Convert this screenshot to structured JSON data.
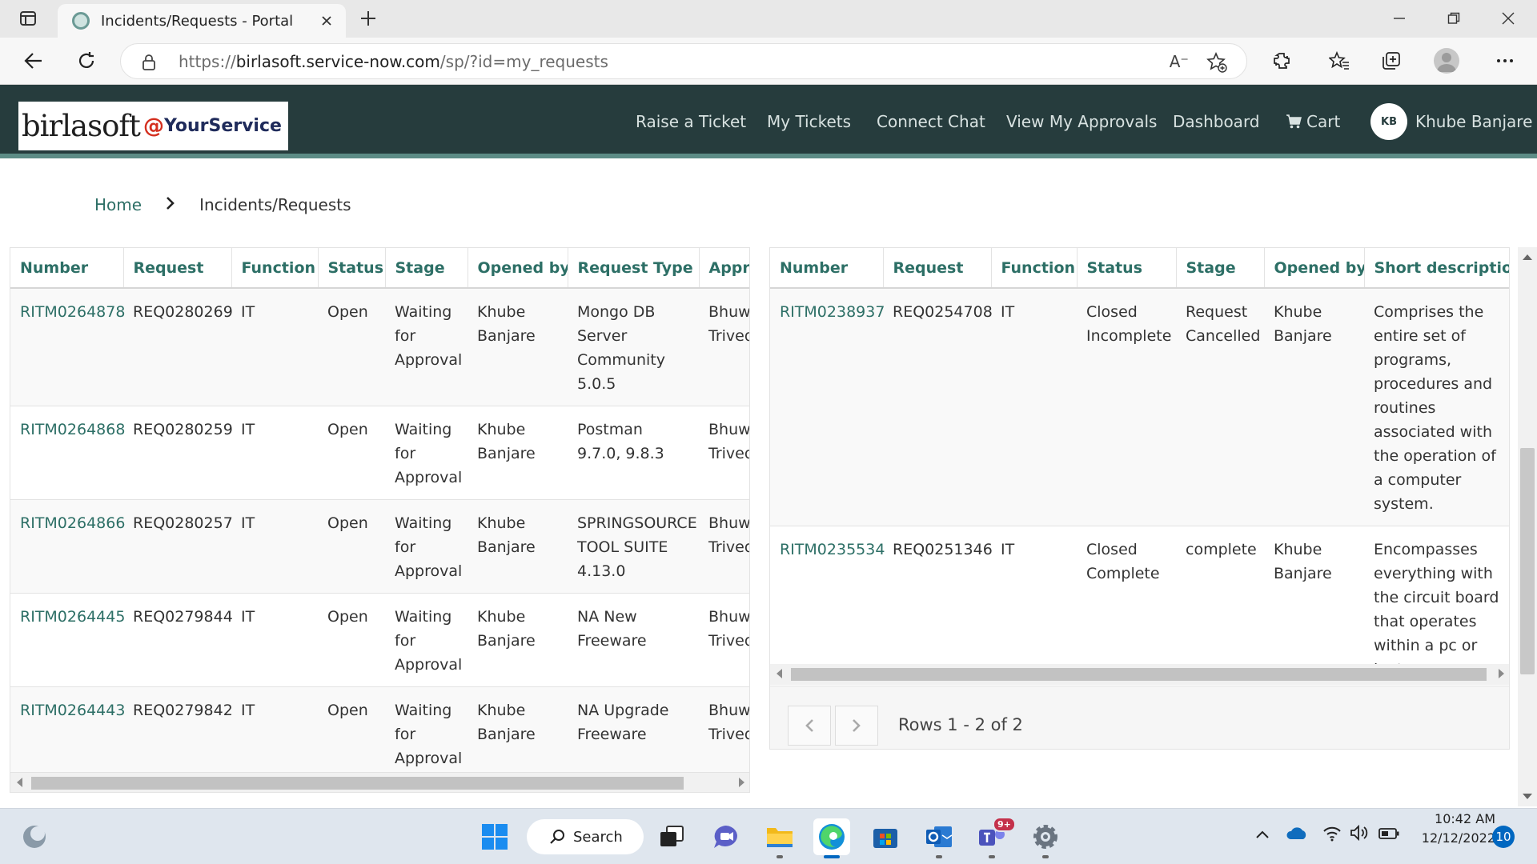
{
  "browser": {
    "tab_title": "Incidents/Requests - Portal",
    "url_prefix": "https://",
    "url_host": "birlasoft.service-now.com",
    "url_path": "/sp/?id=my_requests"
  },
  "header": {
    "logo_text_main": "birlasoft",
    "logo_text_at": "@",
    "logo_text_service": "YourService",
    "nav": {
      "raise": "Raise a Ticket",
      "my_tickets": "My Tickets",
      "chat": "Connect Chat",
      "approvals": "View My Approvals",
      "dashboard": "Dashboard",
      "cart": "Cart"
    },
    "user_initials": "KB",
    "user_name": "Khube Banjare"
  },
  "breadcrumb": {
    "home": "Home",
    "current": "Incidents/Requests"
  },
  "left_table": {
    "columns": [
      "Number",
      "Request",
      "Function",
      "Status",
      "Stage",
      "Opened by",
      "Request Type",
      "Approver"
    ],
    "rows": [
      {
        "number": "RITM0264878",
        "request": "REQ0280269",
        "function": "IT",
        "status": "Open",
        "stage": "Waiting for Approval",
        "opened_by": "Khube Banjare",
        "request_type": "Mongo DB Server Community 5.0.5",
        "approver": "Bhuwan Trivedi"
      },
      {
        "number": "RITM0264868",
        "request": "REQ0280259",
        "function": "IT",
        "status": "Open",
        "stage": "Waiting for Approval",
        "opened_by": "Khube Banjare",
        "request_type": "Postman 9.7.0, 9.8.3",
        "approver": "Bhuwan Trivedi"
      },
      {
        "number": "RITM0264866",
        "request": "REQ0280257",
        "function": "IT",
        "status": "Open",
        "stage": "Waiting for Approval",
        "opened_by": "Khube Banjare",
        "request_type": "SPRINGSOURCE TOOL SUITE 4.13.0",
        "approver": "Bhuwan Trivedi"
      },
      {
        "number": "RITM0264445",
        "request": "REQ0279844",
        "function": "IT",
        "status": "Open",
        "stage": "Waiting for Approval",
        "opened_by": "Khube Banjare",
        "request_type": "NA New Freeware",
        "approver": "Bhuwan Trivedi"
      },
      {
        "number": "RITM0264443",
        "request": "REQ0279842",
        "function": "IT",
        "status": "Open",
        "stage": "Waiting for Approval",
        "opened_by": "Khube Banjare",
        "request_type": "NA Upgrade Freeware",
        "approver": "Bhuwan Trivedi"
      }
    ]
  },
  "right_table": {
    "columns": [
      "Number",
      "Request",
      "Function",
      "Status",
      "Stage",
      "Opened by",
      "Short description"
    ],
    "rows": [
      {
        "number": "RITM0238937",
        "request": "REQ0254708",
        "function": "IT",
        "status": "Closed Incomplete",
        "stage": "Request Cancelled",
        "opened_by": "Khube Banjare",
        "short_description": "Comprises the entire set of programs, procedures and routines associated with the operation of a computer system."
      },
      {
        "number": "RITM0235534",
        "request": "REQ0251346",
        "function": "IT",
        "status": "Closed Complete",
        "stage": "complete",
        "opened_by": "Khube Banjare",
        "short_description": "Encompasses everything with the circuit board that operates within a pc or laptop."
      }
    ],
    "pager_text": "Rows 1 - 2 of 2"
  },
  "taskbar": {
    "search_label": "Search",
    "teams_badge": "9+",
    "time": "10:42 AM",
    "date": "12/12/2022",
    "notification_count": "10"
  },
  "colors": {
    "header_bg": "#263c3d",
    "accent": "#2d6f66",
    "header_underline": "#5d8c86"
  }
}
